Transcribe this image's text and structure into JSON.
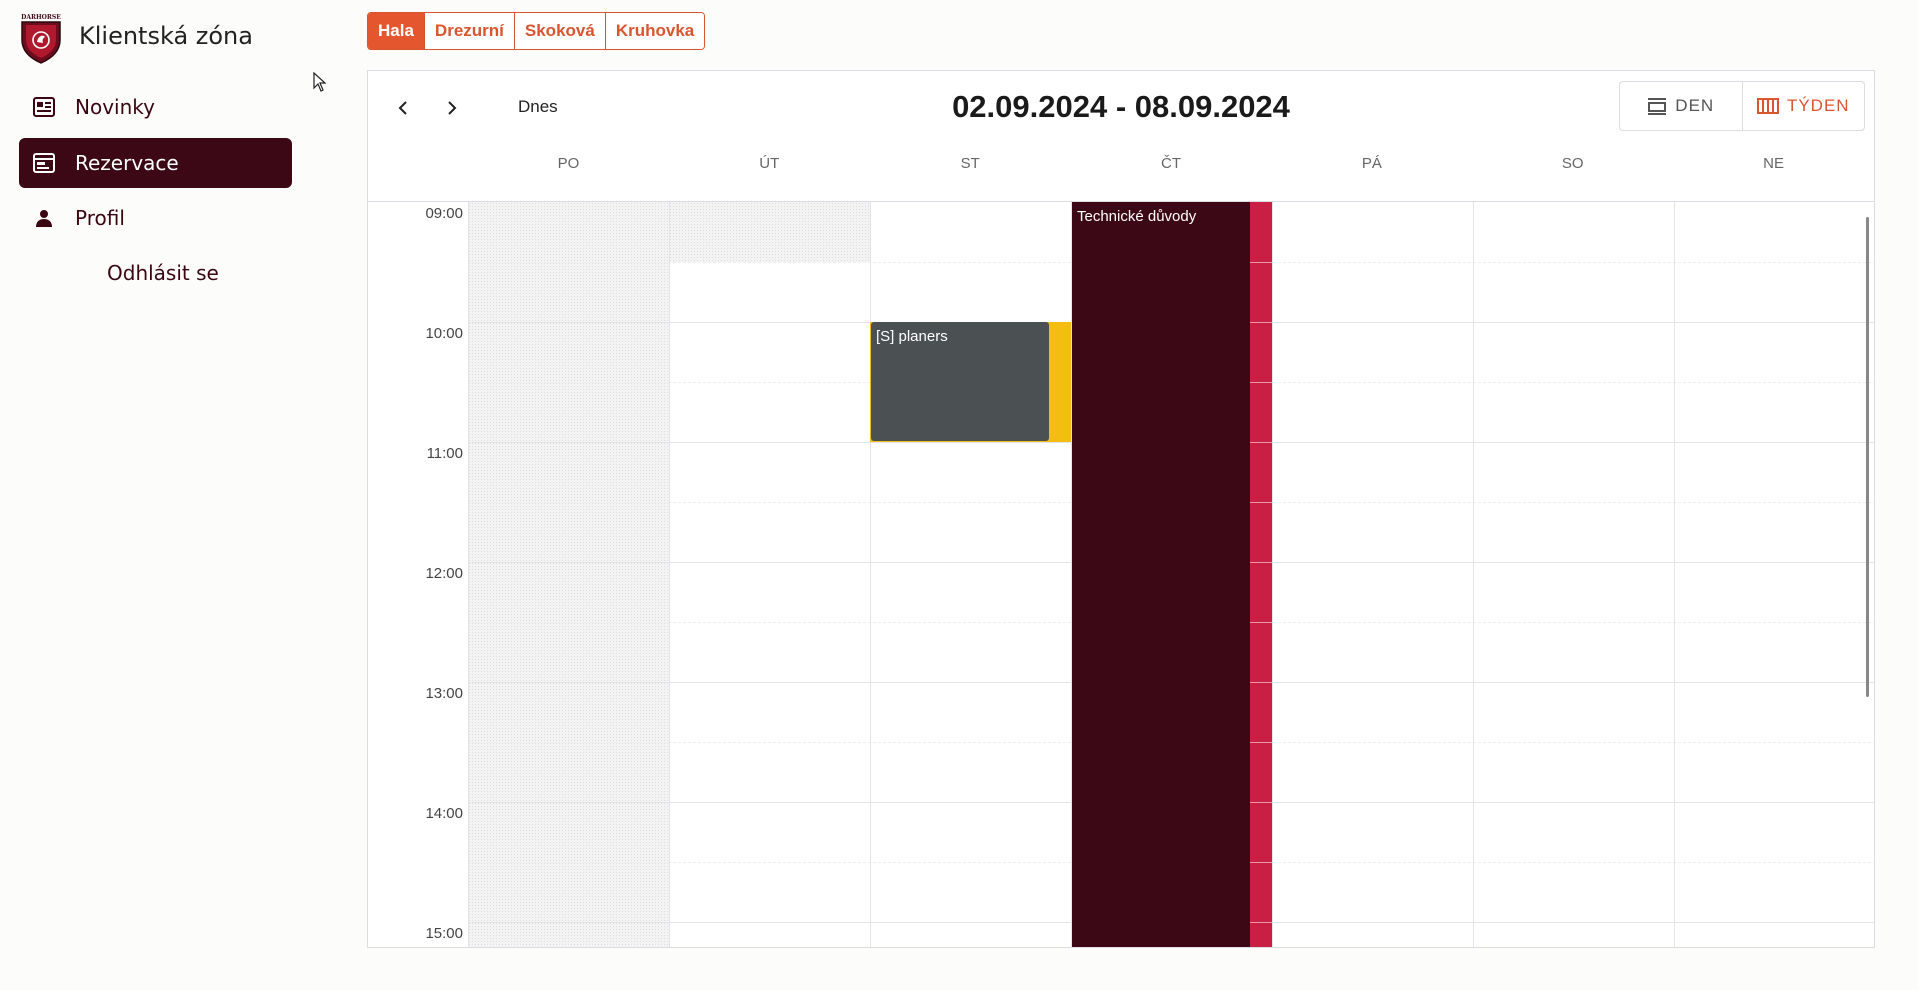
{
  "app": {
    "title": "Klientská zóna",
    "logo_text": "DARHORSE"
  },
  "sidebar": {
    "items": [
      {
        "label": "Novinky",
        "icon": "newspaper-icon"
      },
      {
        "label": "Rezervace",
        "icon": "calendar-icon",
        "active": true
      },
      {
        "label": "Profil",
        "icon": "person-icon"
      }
    ],
    "logout_label": "Odhlásit se"
  },
  "resources": {
    "tabs": [
      "Hala",
      "Drezurní",
      "Skoková",
      "Kruhovka"
    ],
    "active": "Hala"
  },
  "calendar": {
    "today_label": "Dnes",
    "range_title": "02.09.2024 - 08.09.2024",
    "views": [
      {
        "label": "DEN",
        "icon": "day-view-icon"
      },
      {
        "label": "TÝDEN",
        "icon": "week-view-icon",
        "active": true
      }
    ],
    "days": [
      "PO",
      "ÚT",
      "ST",
      "ČT",
      "PÁ",
      "SO",
      "NE"
    ],
    "times": [
      "09:00",
      "10:00",
      "11:00",
      "12:00",
      "13:00",
      "14:00",
      "15:00"
    ],
    "events": [
      {
        "title": "Technické důvody",
        "day": "ČT",
        "start": "09:00",
        "end": "15:00+"
      },
      {
        "title": "[S] planers",
        "day": "ST",
        "start": "10:00",
        "end": "11:00"
      }
    ]
  },
  "colors": {
    "accent": "#e4572e",
    "brand_dark": "#3d0816",
    "event_strip": "#c91f45",
    "event_yellow": "#f3bd12",
    "event_gray": "#4b5153"
  }
}
